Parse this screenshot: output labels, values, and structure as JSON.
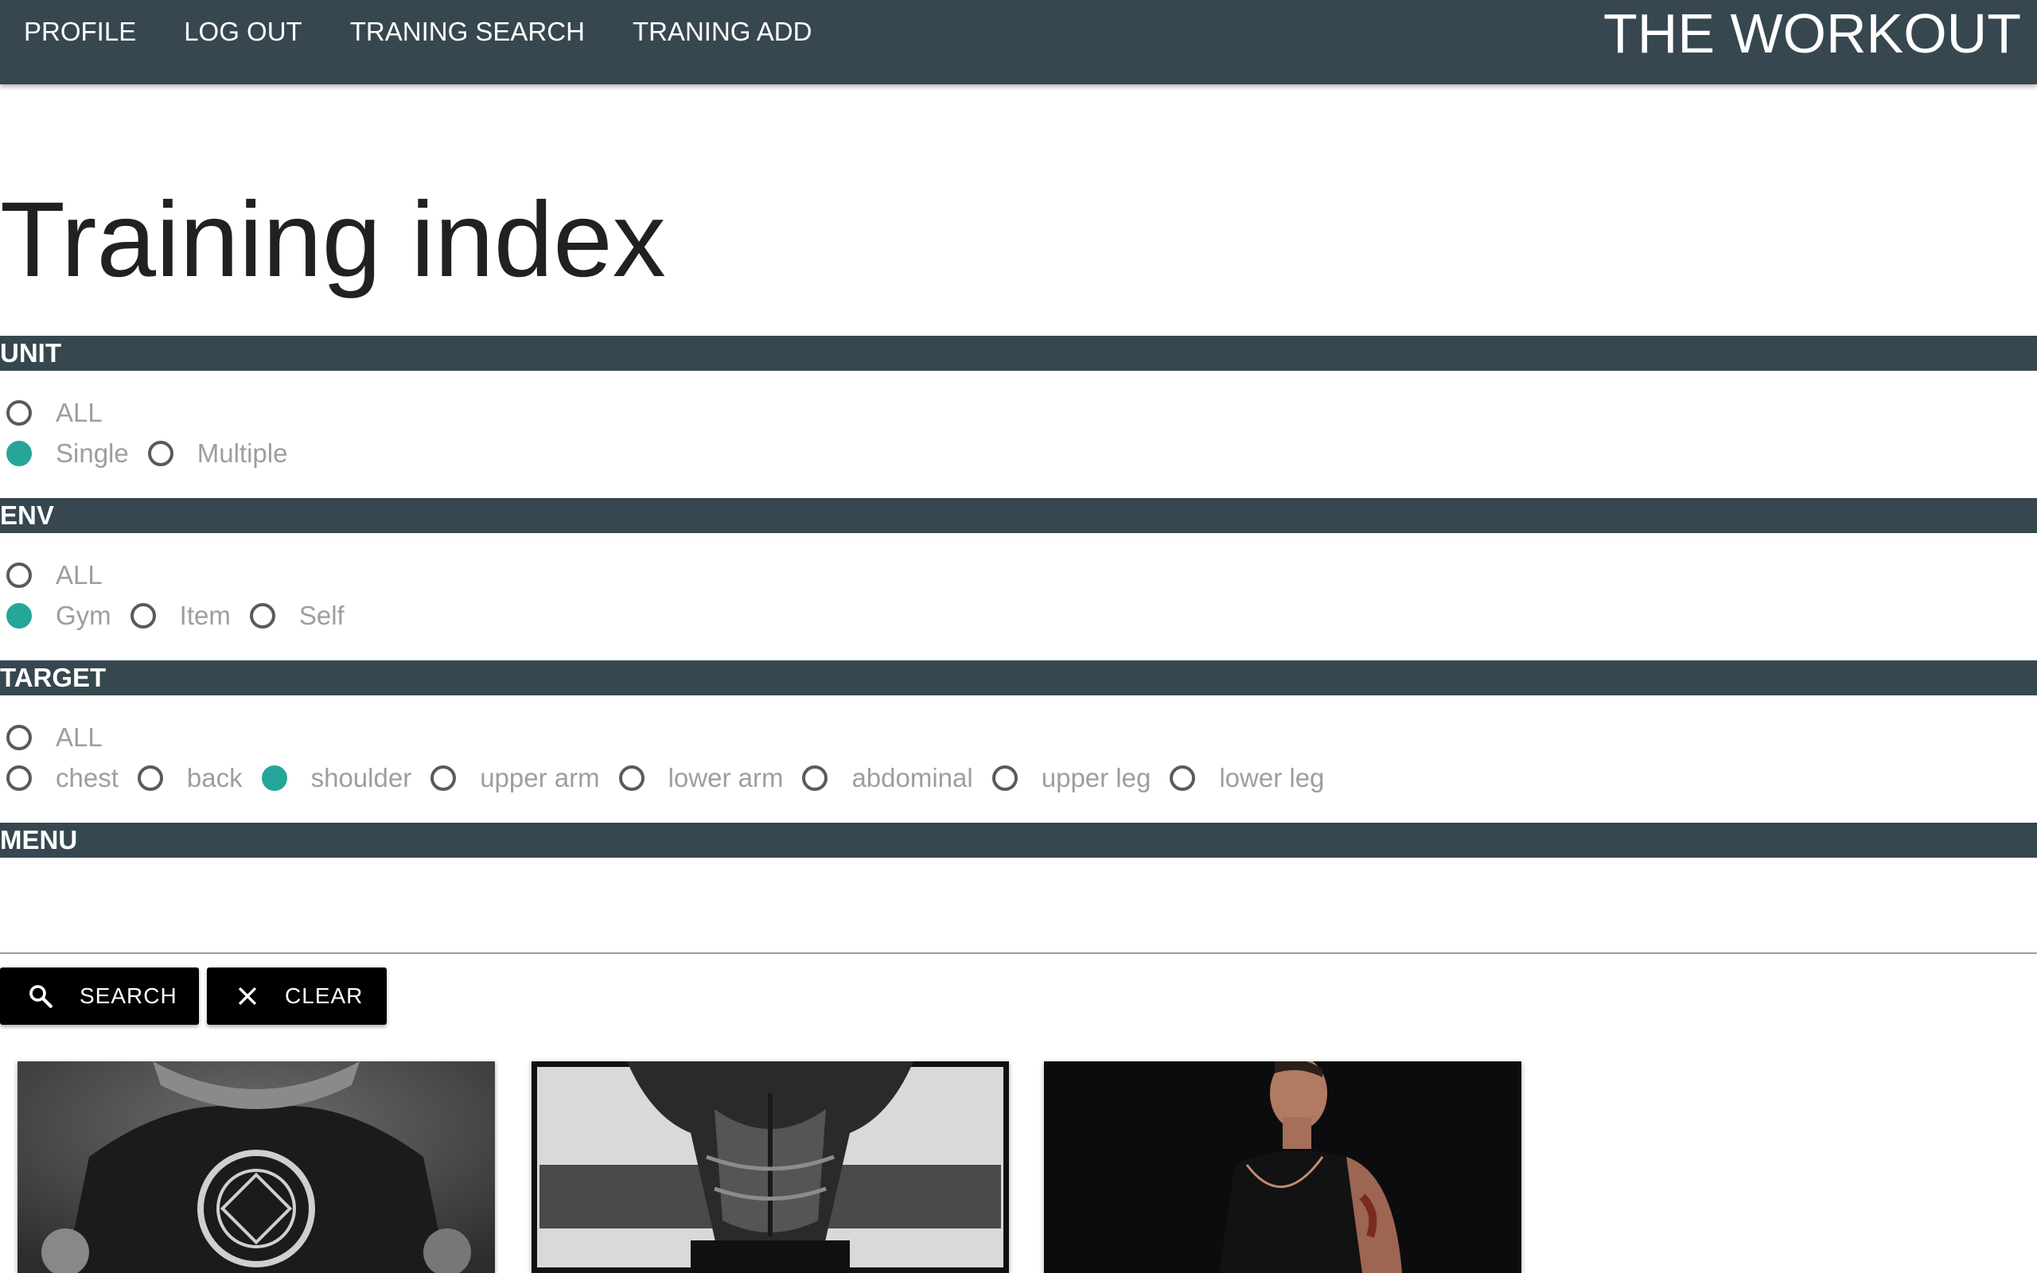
{
  "navbar": {
    "links": [
      "PROFILE",
      "LOG OUT",
      "TRANING SEARCH",
      "TRANING ADD"
    ],
    "brand": "THE WORKOUT",
    "background": "#37474f"
  },
  "page": {
    "title": "Training index"
  },
  "sections": {
    "unit": {
      "header": "UNIT",
      "options": [
        {
          "label": "ALL",
          "checked": false
        },
        {
          "label": "Single",
          "checked": true
        },
        {
          "label": "Multiple",
          "checked": false
        }
      ]
    },
    "env": {
      "header": "ENV",
      "options": [
        {
          "label": "ALL",
          "checked": false
        },
        {
          "label": "Gym",
          "checked": true
        },
        {
          "label": "Item",
          "checked": false
        },
        {
          "label": "Self",
          "checked": false
        }
      ]
    },
    "target": {
      "header": "TARGET",
      "options": [
        {
          "label": "ALL",
          "checked": false
        },
        {
          "label": "chest",
          "checked": false
        },
        {
          "label": "back",
          "checked": false
        },
        {
          "label": "shoulder",
          "checked": true
        },
        {
          "label": "upper arm",
          "checked": false
        },
        {
          "label": "lower arm",
          "checked": false
        },
        {
          "label": "abdominal",
          "checked": false
        },
        {
          "label": "upper leg",
          "checked": false
        },
        {
          "label": "lower leg",
          "checked": false
        }
      ]
    },
    "menu": {
      "header": "MENU"
    }
  },
  "actions": {
    "search_label": "SEARCH",
    "search_icon": "search-icon",
    "clear_label": "CLEAR",
    "clear_icon": "close-icon"
  },
  "colors": {
    "accent": "#26a69a",
    "header_bg": "#37474f",
    "button_bg": "#000000",
    "option_text": "#9e9e9e"
  },
  "cards": [
    {
      "image": "black-and-white photo of athlete in logo t-shirt"
    },
    {
      "image": "black-and-white photo of muscular back"
    },
    {
      "image": "photo of man in black tank top looking up"
    }
  ]
}
